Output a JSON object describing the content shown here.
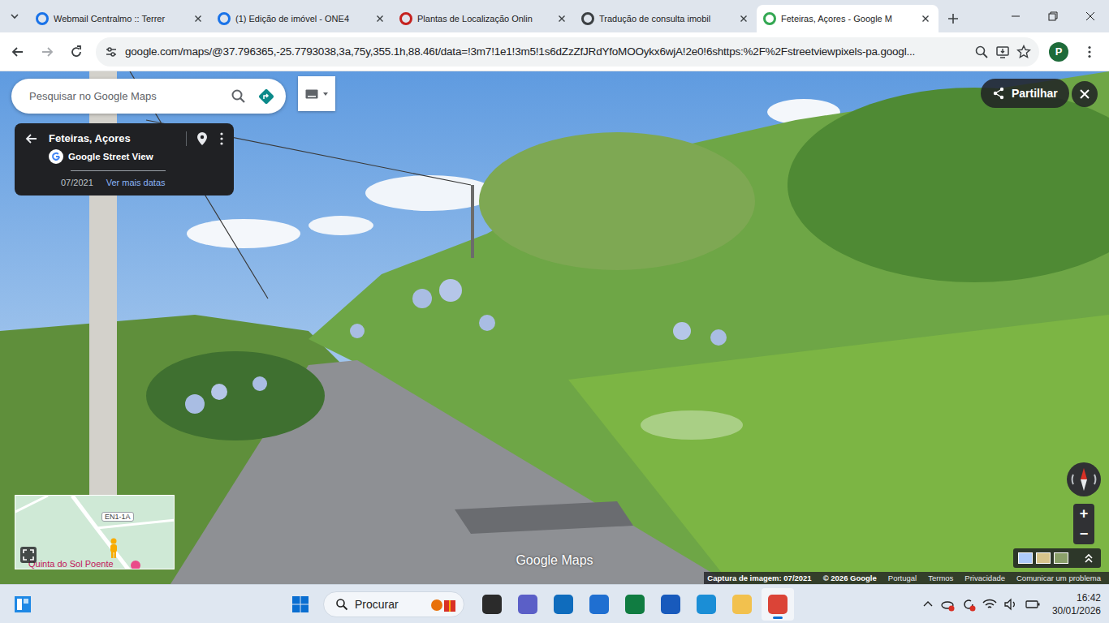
{
  "tabs": [
    {
      "label": "Webmail Centralmo :: Terrer",
      "selected": false,
      "color": "#1a73e8"
    },
    {
      "label": "(1) Edição de imóvel - ONE4",
      "selected": false,
      "color": "#1a73e8"
    },
    {
      "label": "Plantas de Localização Onlin",
      "selected": false,
      "color": "#c5221f"
    },
    {
      "label": "Tradução de consulta imobil",
      "selected": false,
      "color": "#3c4043"
    },
    {
      "label": "Feteiras, Açores - Google M",
      "selected": true,
      "color": "#34a853"
    }
  ],
  "toolbar": {
    "url": "google.com/maps/@37.796365,-25.7793038,3a,75y,355.1h,88.46t/data=!3m7!1e1!3m5!1s6dZzZfJRdYfoMOOykx6wjA!2e0!6shttps:%2F%2Fstreetviewpixels-pa.googl...",
    "profile": "P"
  },
  "maps": {
    "search": {
      "placeholder": "Pesquisar no Google Maps"
    },
    "place_card": {
      "title": "Feteiras, Açores",
      "source": "Google Street View",
      "date": "07/2021",
      "more_dates": "Ver mais datas"
    },
    "share": "Partilhar",
    "zoom": [
      "+",
      "−"
    ],
    "minimap": {
      "road": "EN1-1A",
      "place": "Quinta do Sol Poente"
    },
    "watermark": "Google Maps",
    "footer": [
      "Captura de imagem: 07/2021",
      "© 2026 Google",
      "Portugal",
      "Termos",
      "Privacidade",
      "Comunicar um problema"
    ]
  },
  "taskbar": {
    "search": "Procurar",
    "apps": [
      {
        "name": "task-view",
        "active": false,
        "color": "#2b2b2b"
      },
      {
        "name": "teams",
        "active": false,
        "color": "#5b5fc7"
      },
      {
        "name": "outlook",
        "active": false,
        "color": "#0f6cbd"
      },
      {
        "name": "remote-app",
        "active": false,
        "color": "#1f6fd1"
      },
      {
        "name": "excel",
        "active": false,
        "color": "#107c41"
      },
      {
        "name": "word",
        "active": false,
        "color": "#185abc"
      },
      {
        "name": "edge",
        "active": false,
        "color": "#1b8ed6"
      },
      {
        "name": "file-explorer",
        "active": false,
        "color": "#f2c14e"
      },
      {
        "name": "chrome",
        "active": true,
        "color": "#db4437"
      }
    ],
    "time": "16:42",
    "date": "30/01/2026"
  }
}
